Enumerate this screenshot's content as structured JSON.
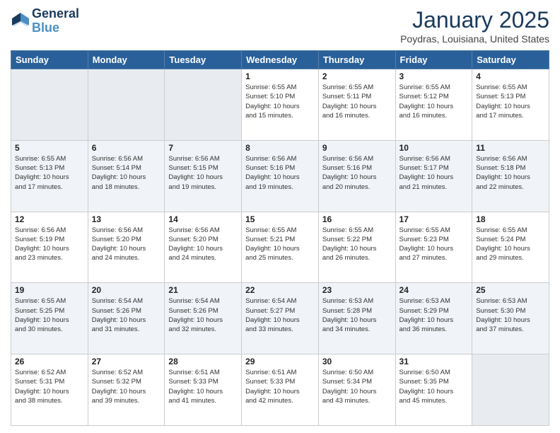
{
  "header": {
    "logo_line1": "General",
    "logo_line2": "Blue",
    "month": "January 2025",
    "location": "Poydras, Louisiana, United States"
  },
  "weekdays": [
    "Sunday",
    "Monday",
    "Tuesday",
    "Wednesday",
    "Thursday",
    "Friday",
    "Saturday"
  ],
  "weeks": [
    [
      {
        "day": "",
        "info": ""
      },
      {
        "day": "",
        "info": ""
      },
      {
        "day": "",
        "info": ""
      },
      {
        "day": "1",
        "info": "Sunrise: 6:55 AM\nSunset: 5:10 PM\nDaylight: 10 hours\nand 15 minutes."
      },
      {
        "day": "2",
        "info": "Sunrise: 6:55 AM\nSunset: 5:11 PM\nDaylight: 10 hours\nand 16 minutes."
      },
      {
        "day": "3",
        "info": "Sunrise: 6:55 AM\nSunset: 5:12 PM\nDaylight: 10 hours\nand 16 minutes."
      },
      {
        "day": "4",
        "info": "Sunrise: 6:55 AM\nSunset: 5:13 PM\nDaylight: 10 hours\nand 17 minutes."
      }
    ],
    [
      {
        "day": "5",
        "info": "Sunrise: 6:55 AM\nSunset: 5:13 PM\nDaylight: 10 hours\nand 17 minutes."
      },
      {
        "day": "6",
        "info": "Sunrise: 6:56 AM\nSunset: 5:14 PM\nDaylight: 10 hours\nand 18 minutes."
      },
      {
        "day": "7",
        "info": "Sunrise: 6:56 AM\nSunset: 5:15 PM\nDaylight: 10 hours\nand 19 minutes."
      },
      {
        "day": "8",
        "info": "Sunrise: 6:56 AM\nSunset: 5:16 PM\nDaylight: 10 hours\nand 19 minutes."
      },
      {
        "day": "9",
        "info": "Sunrise: 6:56 AM\nSunset: 5:16 PM\nDaylight: 10 hours\nand 20 minutes."
      },
      {
        "day": "10",
        "info": "Sunrise: 6:56 AM\nSunset: 5:17 PM\nDaylight: 10 hours\nand 21 minutes."
      },
      {
        "day": "11",
        "info": "Sunrise: 6:56 AM\nSunset: 5:18 PM\nDaylight: 10 hours\nand 22 minutes."
      }
    ],
    [
      {
        "day": "12",
        "info": "Sunrise: 6:56 AM\nSunset: 5:19 PM\nDaylight: 10 hours\nand 23 minutes."
      },
      {
        "day": "13",
        "info": "Sunrise: 6:56 AM\nSunset: 5:20 PM\nDaylight: 10 hours\nand 24 minutes."
      },
      {
        "day": "14",
        "info": "Sunrise: 6:56 AM\nSunset: 5:20 PM\nDaylight: 10 hours\nand 24 minutes."
      },
      {
        "day": "15",
        "info": "Sunrise: 6:55 AM\nSunset: 5:21 PM\nDaylight: 10 hours\nand 25 minutes."
      },
      {
        "day": "16",
        "info": "Sunrise: 6:55 AM\nSunset: 5:22 PM\nDaylight: 10 hours\nand 26 minutes."
      },
      {
        "day": "17",
        "info": "Sunrise: 6:55 AM\nSunset: 5:23 PM\nDaylight: 10 hours\nand 27 minutes."
      },
      {
        "day": "18",
        "info": "Sunrise: 6:55 AM\nSunset: 5:24 PM\nDaylight: 10 hours\nand 29 minutes."
      }
    ],
    [
      {
        "day": "19",
        "info": "Sunrise: 6:55 AM\nSunset: 5:25 PM\nDaylight: 10 hours\nand 30 minutes."
      },
      {
        "day": "20",
        "info": "Sunrise: 6:54 AM\nSunset: 5:26 PM\nDaylight: 10 hours\nand 31 minutes."
      },
      {
        "day": "21",
        "info": "Sunrise: 6:54 AM\nSunset: 5:26 PM\nDaylight: 10 hours\nand 32 minutes."
      },
      {
        "day": "22",
        "info": "Sunrise: 6:54 AM\nSunset: 5:27 PM\nDaylight: 10 hours\nand 33 minutes."
      },
      {
        "day": "23",
        "info": "Sunrise: 6:53 AM\nSunset: 5:28 PM\nDaylight: 10 hours\nand 34 minutes."
      },
      {
        "day": "24",
        "info": "Sunrise: 6:53 AM\nSunset: 5:29 PM\nDaylight: 10 hours\nand 36 minutes."
      },
      {
        "day": "25",
        "info": "Sunrise: 6:53 AM\nSunset: 5:30 PM\nDaylight: 10 hours\nand 37 minutes."
      }
    ],
    [
      {
        "day": "26",
        "info": "Sunrise: 6:52 AM\nSunset: 5:31 PM\nDaylight: 10 hours\nand 38 minutes."
      },
      {
        "day": "27",
        "info": "Sunrise: 6:52 AM\nSunset: 5:32 PM\nDaylight: 10 hours\nand 39 minutes."
      },
      {
        "day": "28",
        "info": "Sunrise: 6:51 AM\nSunset: 5:33 PM\nDaylight: 10 hours\nand 41 minutes."
      },
      {
        "day": "29",
        "info": "Sunrise: 6:51 AM\nSunset: 5:33 PM\nDaylight: 10 hours\nand 42 minutes."
      },
      {
        "day": "30",
        "info": "Sunrise: 6:50 AM\nSunset: 5:34 PM\nDaylight: 10 hours\nand 43 minutes."
      },
      {
        "day": "31",
        "info": "Sunrise: 6:50 AM\nSunset: 5:35 PM\nDaylight: 10 hours\nand 45 minutes."
      },
      {
        "day": "",
        "info": ""
      }
    ]
  ]
}
